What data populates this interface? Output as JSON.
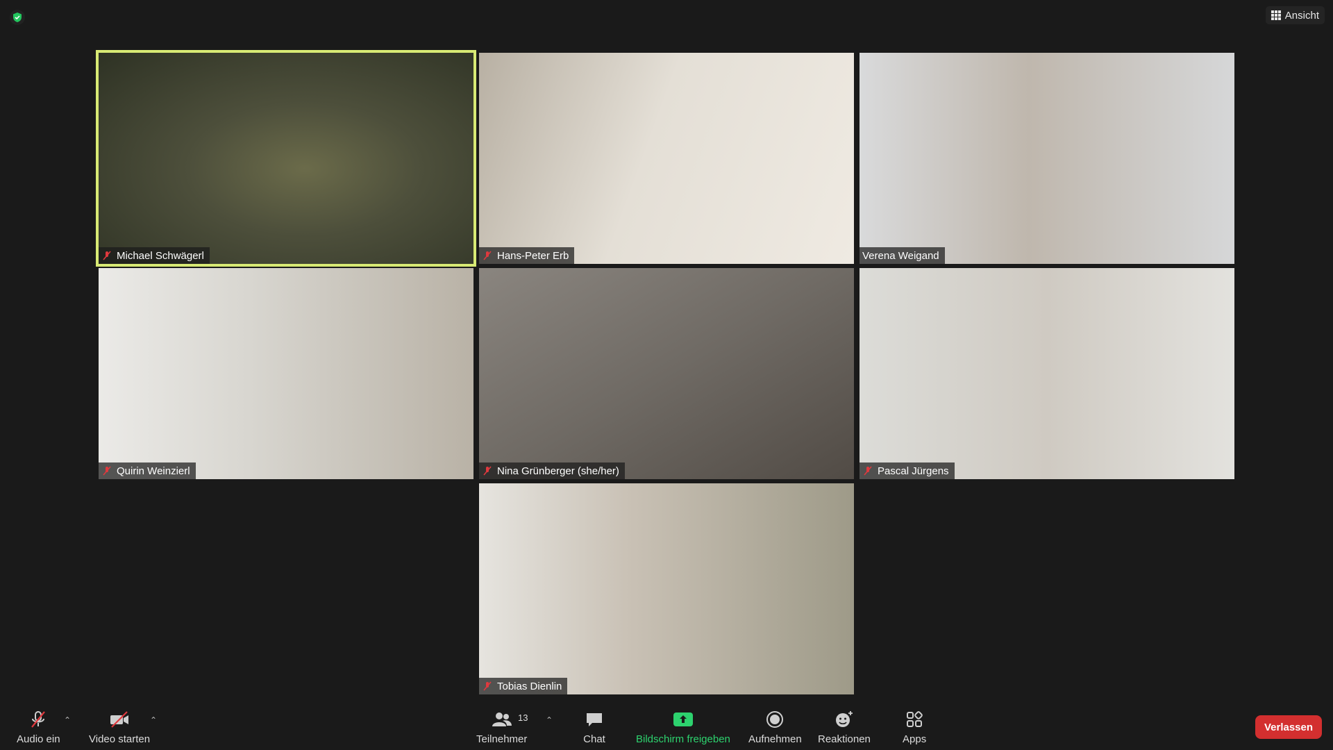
{
  "header": {
    "view_label": "Ansicht"
  },
  "participants": [
    {
      "name": "Michael Schwägerl"
    },
    {
      "name": "Hans-Peter Erb"
    },
    {
      "name": "Verena Weigand"
    },
    {
      "name": "Quirin Weinzierl"
    },
    {
      "name": "Nina Grünberger (she/her)"
    },
    {
      "name": "Pascal Jürgens"
    },
    {
      "name": "Tobias Dienlin"
    }
  ],
  "toolbar": {
    "audio_label": "Audio ein",
    "video_label": "Video starten",
    "participants_label": "Teilnehmer",
    "participants_count": "13",
    "chat_label": "Chat",
    "share_label": "Bildschirm freigeben",
    "record_label": "Aufnehmen",
    "reactions_label": "Reaktionen",
    "apps_label": "Apps",
    "leave_label": "Verlassen"
  },
  "colors": {
    "active_speaker_border": "#d8ea74",
    "share_green": "#2dd26e",
    "leave_red": "#d32f2f",
    "muted_red": "#e0393e"
  }
}
